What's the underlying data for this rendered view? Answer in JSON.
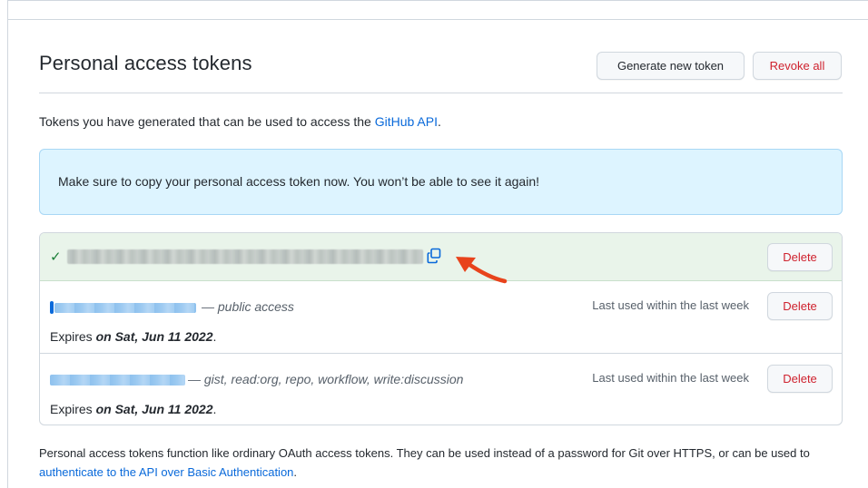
{
  "header": {
    "title": "Personal access tokens",
    "generate_label": "Generate new token",
    "revoke_label": "Revoke all"
  },
  "intro": {
    "text_before": "Tokens you have generated that can be used to access the ",
    "link_text": "GitHub API",
    "text_after": "."
  },
  "flash": {
    "message": "Make sure to copy your personal access token now. You won’t be able to see it again!"
  },
  "tokens": {
    "new_token": {
      "delete_label": "Delete",
      "icon": "check-icon",
      "copy_icon": "copy-icon"
    },
    "items": [
      {
        "scopes": "— public access",
        "last_used": "Last used within the last week",
        "expires_prefix": "Expires ",
        "expires_date": "on Sat, Jun 11 2022",
        "expires_suffix": ".",
        "delete_label": "Delete"
      },
      {
        "scopes": "— gist, read:org, repo, workflow, write:discussion",
        "last_used": "Last used within the last week",
        "expires_prefix": "Expires ",
        "expires_date": "on Sat, Jun 11 2022",
        "expires_suffix": ".",
        "delete_label": "Delete"
      }
    ]
  },
  "footer": {
    "text_before": "Personal access tokens function like ordinary OAuth access tokens. They can be used instead of a password for Git over HTTPS, or can be used to ",
    "link_text": "authenticate to the API over Basic Authentication",
    "text_after": "."
  },
  "colors": {
    "link": "#0969da",
    "danger": "#cf222e",
    "success": "#1a7f37",
    "flash_bg": "#ddf4ff",
    "new_token_bg": "#e9f4ea",
    "arrow": "#e8431c"
  }
}
